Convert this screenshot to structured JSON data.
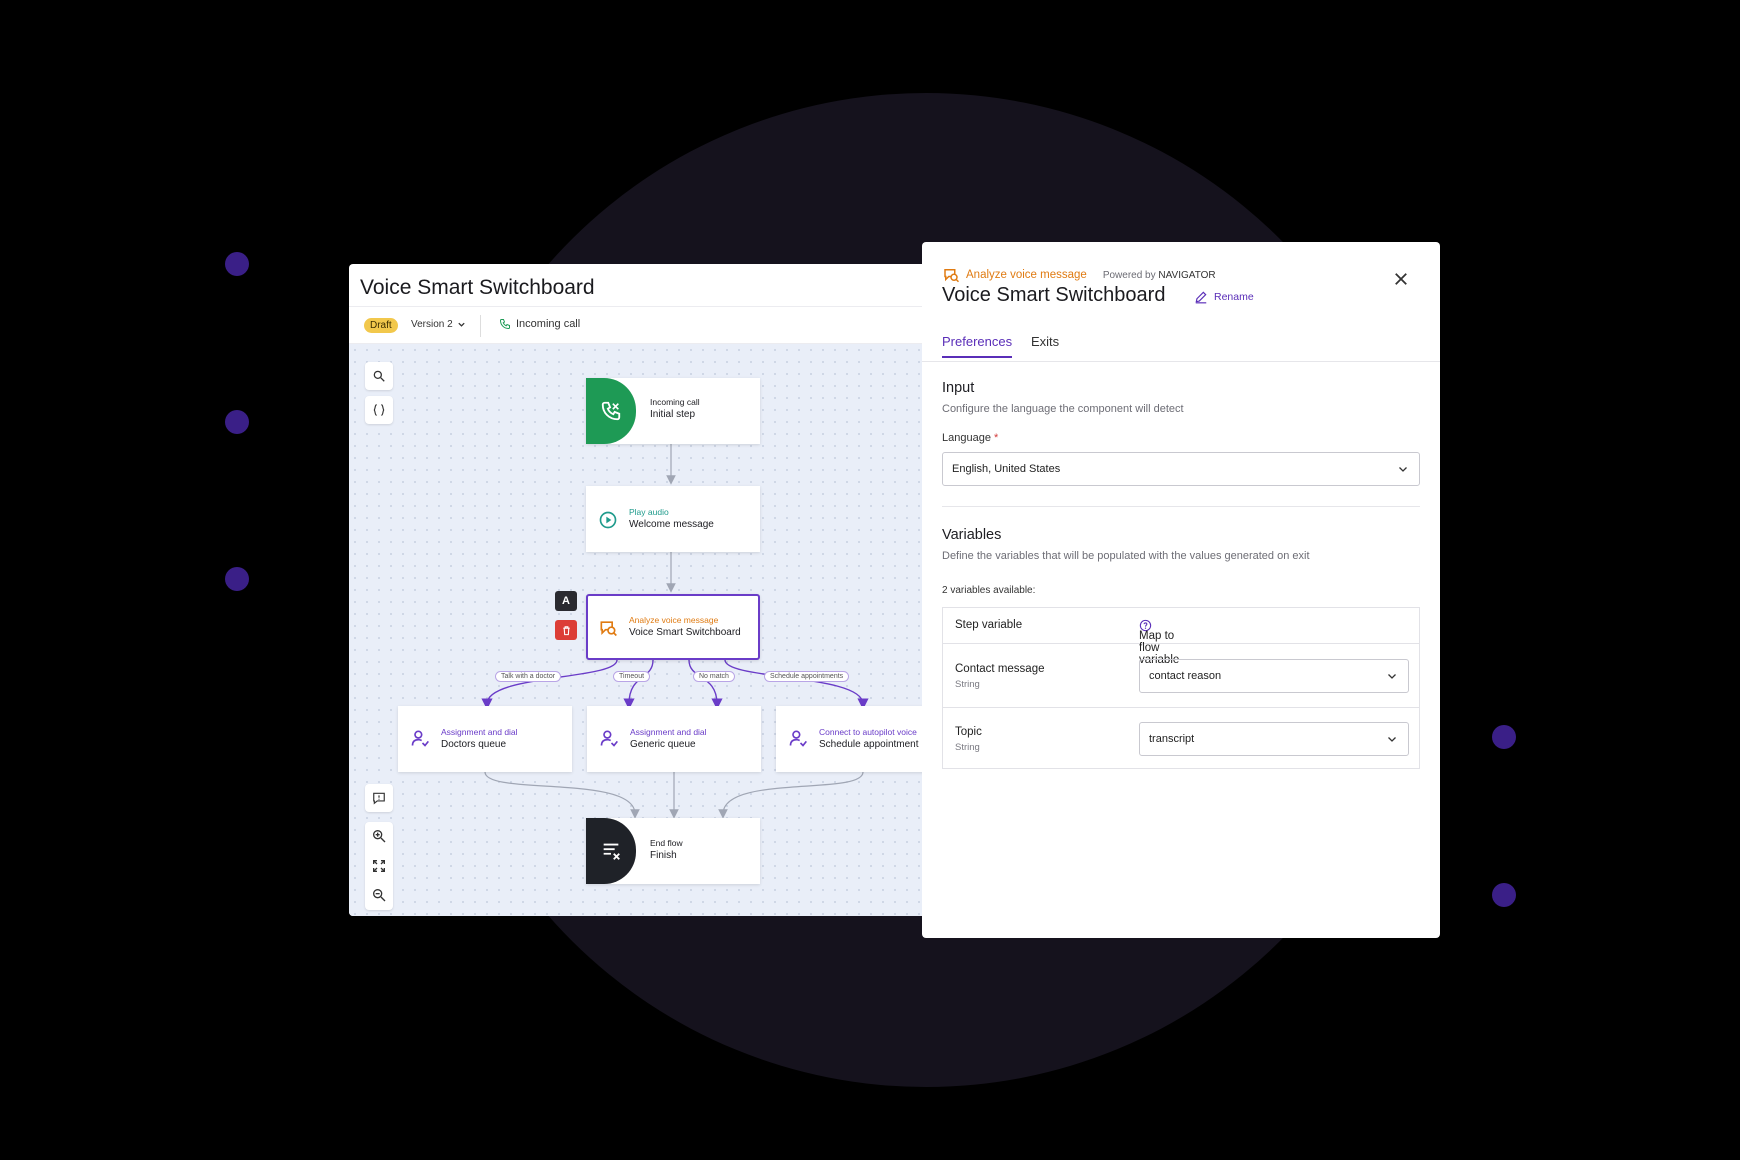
{
  "editor": {
    "title": "Voice Smart Switchboard",
    "status_badge": "Draft",
    "version": "Version 2",
    "trigger": "Incoming call"
  },
  "flow": {
    "nodes": {
      "incoming": {
        "kind": "Incoming call",
        "name": "Initial step"
      },
      "play": {
        "kind": "Play audio",
        "name": "Welcome message"
      },
      "analyze": {
        "kind": "Analyze voice message",
        "name": "Voice Smart Switchboard"
      },
      "doctors": {
        "kind": "Assignment and dial",
        "name": "Doctors queue"
      },
      "generic": {
        "kind": "Assignment and dial",
        "name": "Generic queue"
      },
      "autopilot": {
        "kind": "Connect to autopilot voice",
        "name": "Schedule appointment"
      },
      "end": {
        "kind": "End flow",
        "name": "Finish"
      }
    },
    "edges": [
      "Talk with a doctor",
      "Timeout",
      "No match",
      "Schedule appointments"
    ],
    "side_badge": "A"
  },
  "panel": {
    "kind": "Analyze voice message",
    "powered_by": "Powered by",
    "provider": "NAVIGATOR",
    "title": "Voice Smart Switchboard",
    "rename": "Rename",
    "tabs": [
      "Preferences",
      "Exits"
    ],
    "input": {
      "title": "Input",
      "description": "Configure the language the component will detect",
      "language_label": "Language",
      "required_mark": "*",
      "language_value": "English, United States"
    },
    "variables": {
      "title": "Variables",
      "description": "Define the variables that will be populated with the values generated on exit",
      "count_text": "2 variables available:",
      "col_step": "Step variable",
      "col_map": "Map to flow variable",
      "rows": [
        {
          "name": "Contact message",
          "type": "String",
          "value": "contact reason"
        },
        {
          "name": "Topic",
          "type": "String",
          "value": "transcript"
        }
      ]
    }
  },
  "colors": {
    "accent": "#5a2eb8",
    "orange": "#e07b12",
    "green": "#1e9a55",
    "teal": "#1f9b8c",
    "draft": "#f2c84c",
    "danger": "#dc3d36"
  },
  "icons": [
    "search-icon",
    "braces-icon",
    "phone-icon",
    "play-icon",
    "voice-analyze-icon",
    "agent-icon",
    "end-flow-icon",
    "comment-icon",
    "zoom-in-icon",
    "fit-icon",
    "zoom-out-icon",
    "close-icon",
    "pencil-icon",
    "help-icon",
    "chevron-down-icon",
    "trash-icon"
  ]
}
